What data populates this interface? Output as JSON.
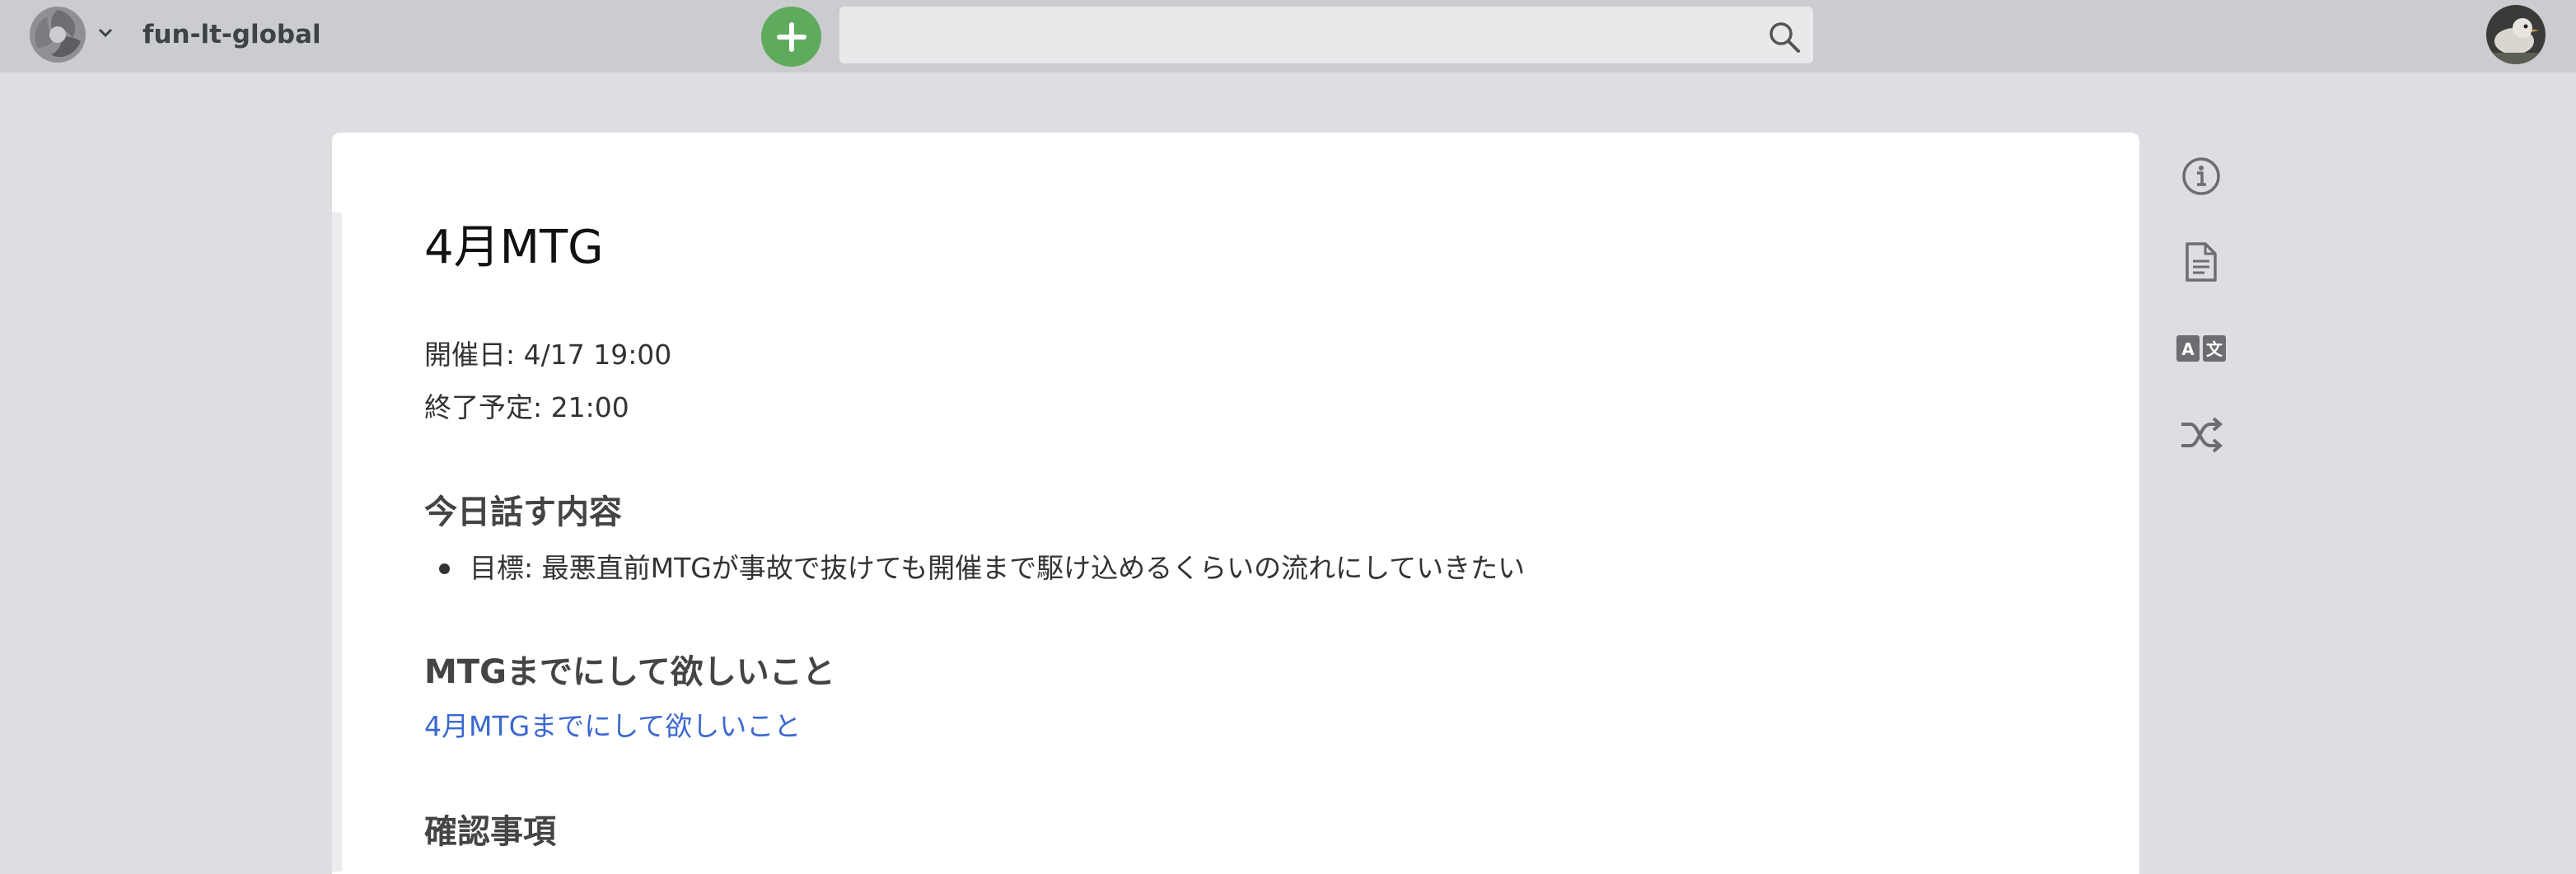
{
  "header": {
    "project_name": "fun-lt-global",
    "search": {
      "placeholder": "",
      "value": ""
    }
  },
  "page": {
    "title": "4月MTG",
    "meta": [
      "開催日: 4/17 19:00",
      "終了予定: 21:00"
    ],
    "sections": [
      {
        "heading": "今日話す内容",
        "bullets": [
          "目標: 最悪直前MTGが事故で抜けても開催まで駆け込めるくらいの流れにしていきたい"
        ]
      },
      {
        "heading": "MTGまでにして欲しいこと",
        "link": "4月MTGまでにして欲しいこと"
      },
      {
        "heading": "確認事項"
      }
    ]
  },
  "side_tools": [
    "info-icon",
    "document-icon",
    "translate-icon",
    "shuffle-icon"
  ],
  "colors": {
    "add_button": "#5fab5d",
    "link": "#3b68d0",
    "topbar": "#cbccd0",
    "background": "#dddee1"
  }
}
